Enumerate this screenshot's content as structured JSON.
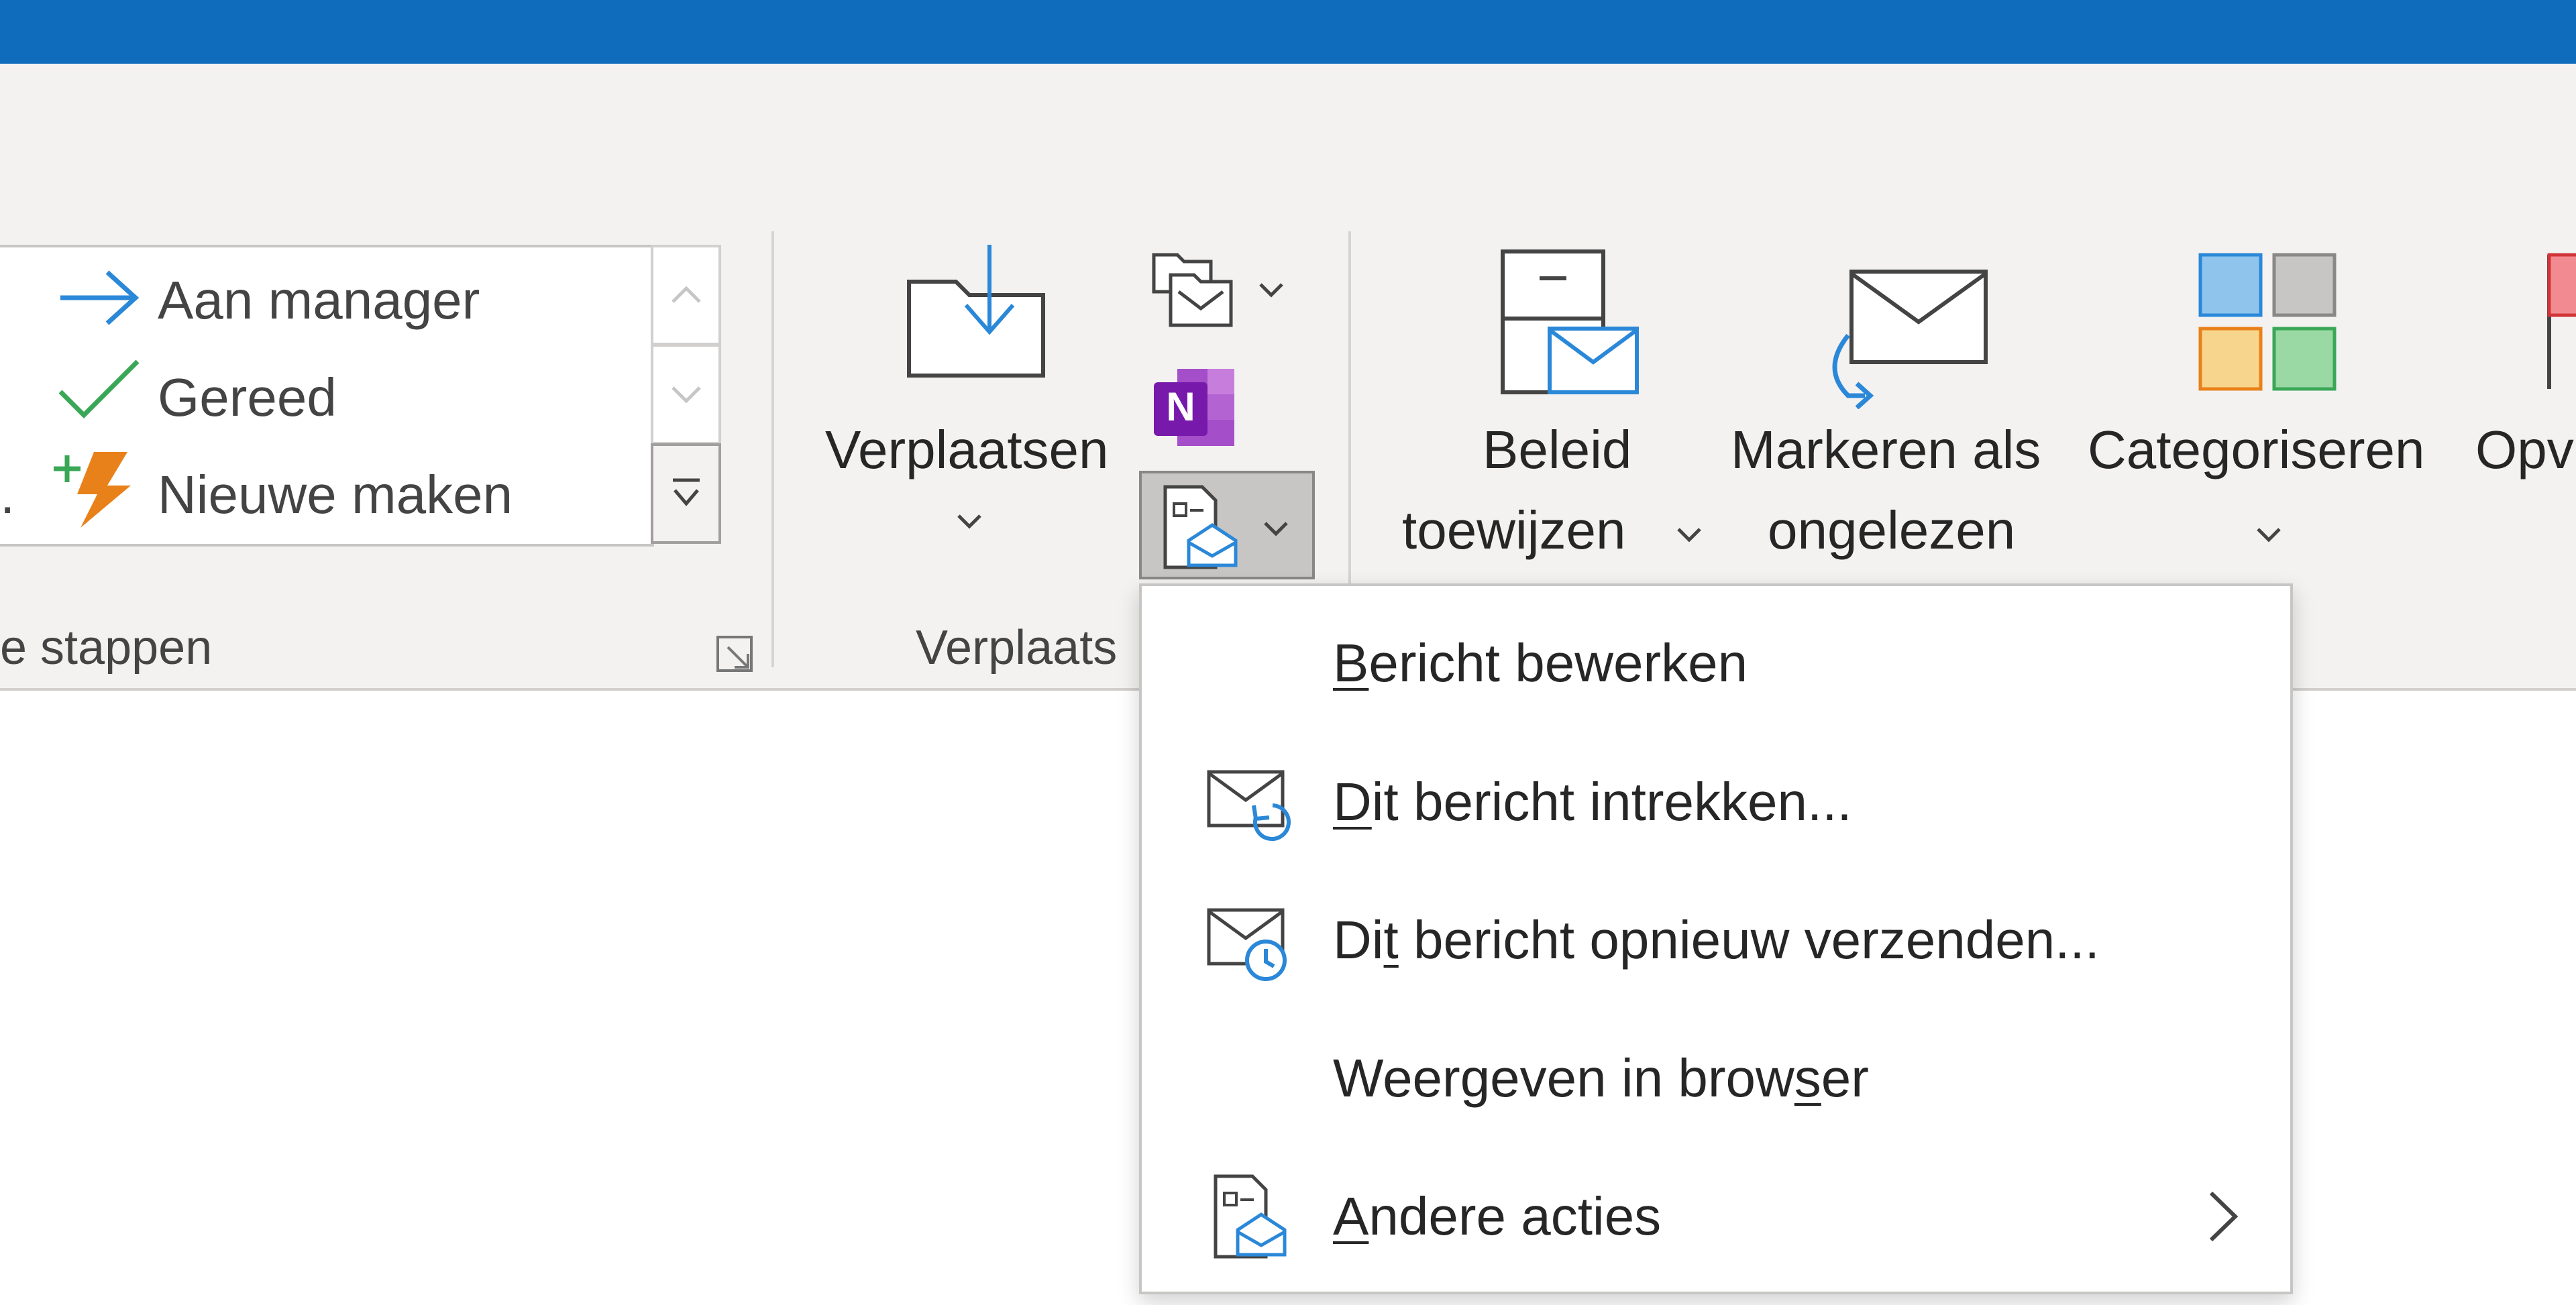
{
  "ribbon": {
    "quick_steps": {
      "items": [
        {
          "label": "Aan manager",
          "icon": "arrow-right-icon"
        },
        {
          "label": "Gereed",
          "icon": "checkmark-icon"
        },
        {
          "label": "Nieuwe maken",
          "icon": "lightning-plus-icon"
        }
      ],
      "clipped_prefix": ".",
      "group_label": "e stappen"
    },
    "move_group": {
      "verplaatsen": {
        "label": "Verplaatsen",
        "icon": "folder-move-icon"
      },
      "group_label": "Verplaats",
      "small_buttons": [
        {
          "name": "rules",
          "icon": "rules-folder-icon"
        },
        {
          "name": "onenote",
          "icon": "onenote-icon"
        },
        {
          "name": "actions",
          "icon": "message-actions-icon"
        }
      ]
    },
    "tags_group": {
      "beleid": {
        "line1": "Beleid",
        "line2": "toewijzen",
        "icon": "cabinet-mail-icon"
      },
      "markeren": {
        "line1": "Markeren als",
        "line2": "ongelezen",
        "icon": "envelope-refresh-icon"
      },
      "categoriseren": {
        "label": "Categoriseren",
        "icon": "color-categories-icon"
      },
      "opvolgen": {
        "label": "Opv",
        "icon": "flag-icon"
      }
    }
  },
  "menu": {
    "items": [
      {
        "pre": "",
        "key": "B",
        "post": "ericht bewerken",
        "icon": "",
        "submenu": false
      },
      {
        "pre": "",
        "key": "D",
        "post": "it bericht intrekken...",
        "icon": "recall-message-icon",
        "submenu": false
      },
      {
        "pre": "Di",
        "key": "t",
        "post": " bericht opnieuw verzenden...",
        "icon": "resend-message-icon",
        "submenu": false
      },
      {
        "pre": "Weergeven in brow",
        "key": "s",
        "post": "er",
        "icon": "",
        "submenu": false
      },
      {
        "pre": "",
        "key": "A",
        "post": "ndere acties",
        "icon": "other-actions-icon",
        "submenu": true
      }
    ]
  },
  "colors": {
    "titlebar": "#0f6cbd",
    "ribbon_bg": "#f3f2f1",
    "accent_blue": "#2b88d8",
    "onenote_purple": "#7719aa",
    "quickstep_green": "#3aa757",
    "quickstep_orange": "#e8811a"
  }
}
